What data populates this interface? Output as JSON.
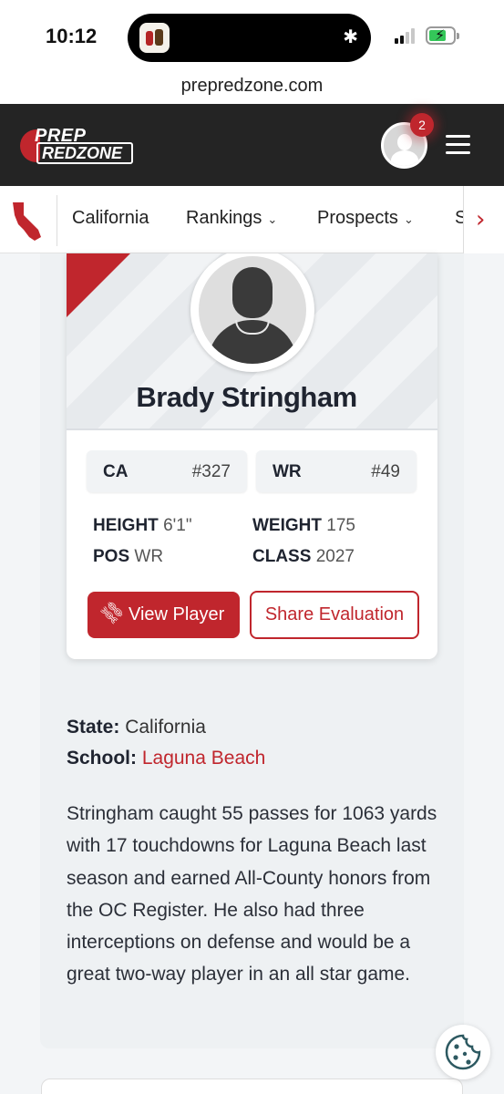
{
  "status_bar": {
    "time": "10:12"
  },
  "browser": {
    "url": "prepredzone.com"
  },
  "header": {
    "logo_line1": "PREP",
    "logo_line2": "REDZONE",
    "notification_count": "2"
  },
  "nav": {
    "items": [
      {
        "label": "California",
        "dropdown": false
      },
      {
        "label": "Rankings",
        "dropdown": true
      },
      {
        "label": "Prospects",
        "dropdown": true
      },
      {
        "label": "S",
        "dropdown": false
      }
    ]
  },
  "player": {
    "name": "Brady Stringham",
    "state_rank": {
      "label": "CA",
      "value": "#327"
    },
    "position_rank": {
      "label": "WR",
      "value": "#49"
    },
    "height": {
      "label": "HEIGHT",
      "value": "6'1\""
    },
    "weight": {
      "label": "WEIGHT",
      "value": "175"
    },
    "pos": {
      "label": "POS",
      "value": "WR"
    },
    "class": {
      "label": "CLASS",
      "value": "2027"
    },
    "view_button": "View Player",
    "share_button": "Share Evaluation"
  },
  "details": {
    "state_label": "State:",
    "state_value": "California",
    "school_label": "School:",
    "school_value": "Laguna Beach",
    "bio": "Stringham caught 55 passes for 1063 yards with 17 touchdowns for Laguna Beach last season and earned All-County honors from the OC Register. He also had three interceptions on defense and would be a great two-way player in an all star game."
  },
  "colors": {
    "brand_red": "#c0262d",
    "header_dark": "#242424"
  },
  "icons": [
    "bluetooth-icon",
    "signal-icon",
    "battery-icon",
    "avatar-icon",
    "menu-icon",
    "california-flag-icon",
    "chevron-down-icon",
    "chevron-right-icon",
    "link-icon",
    "cookie-icon"
  ]
}
